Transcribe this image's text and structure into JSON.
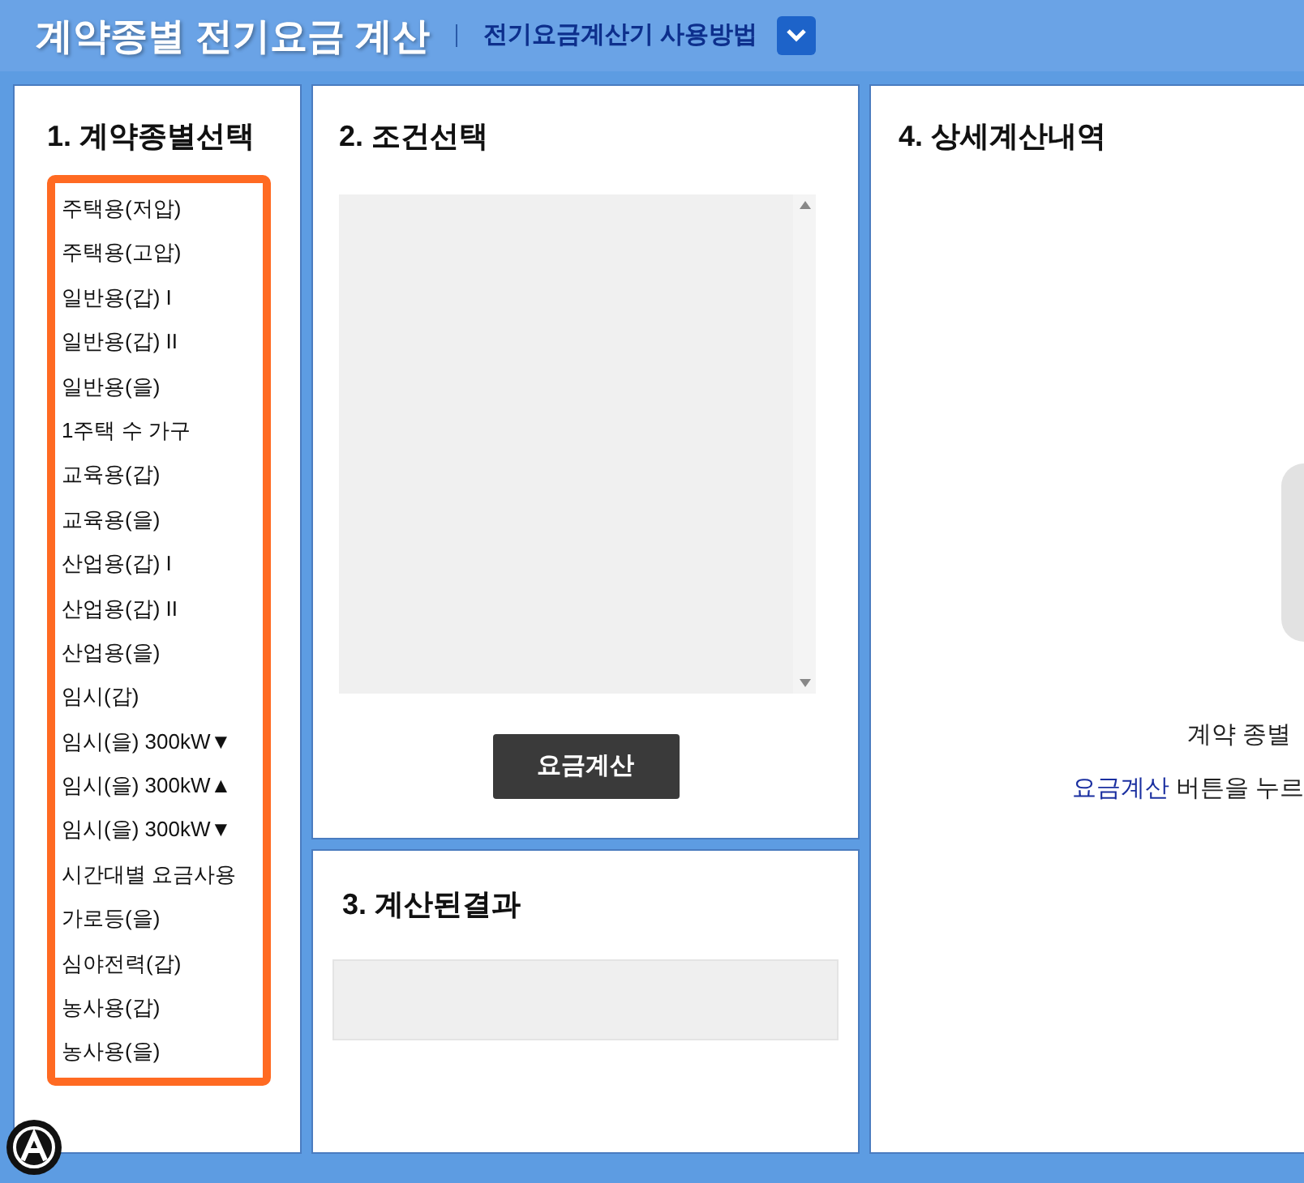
{
  "header": {
    "title": "계약종별 전기요금 계산",
    "guide_link": "전기요금계산기 사용방법"
  },
  "contract_panel": {
    "heading": "1. 계약종별선택",
    "items": [
      "주택용(저압)",
      "주택용(고압)",
      "일반용(갑) I",
      "일반용(갑) II",
      "일반용(을)",
      "1주택 수 가구",
      "교육용(갑)",
      "교육용(을)",
      "산업용(갑) I",
      "산업용(갑) II",
      "산업용(을)",
      "임시(갑)",
      "임시(을) 300kW▼",
      "임시(을) 300kW▲",
      "임시(을) 300kW▼",
      "시간대별 요금사용",
      "가로등(을)",
      "심야전력(갑)",
      "농사용(갑)",
      "농사용(을)"
    ]
  },
  "condition_panel": {
    "heading": "2. 조건선택",
    "button": "요금계산"
  },
  "result_panel": {
    "heading": "3. 계산된결과"
  },
  "detail_panel": {
    "heading": "4. 상세계산내역",
    "message_line_1": "계약 종별",
    "message_link": "요금계산",
    "message_line_2": "버튼을 누르"
  }
}
